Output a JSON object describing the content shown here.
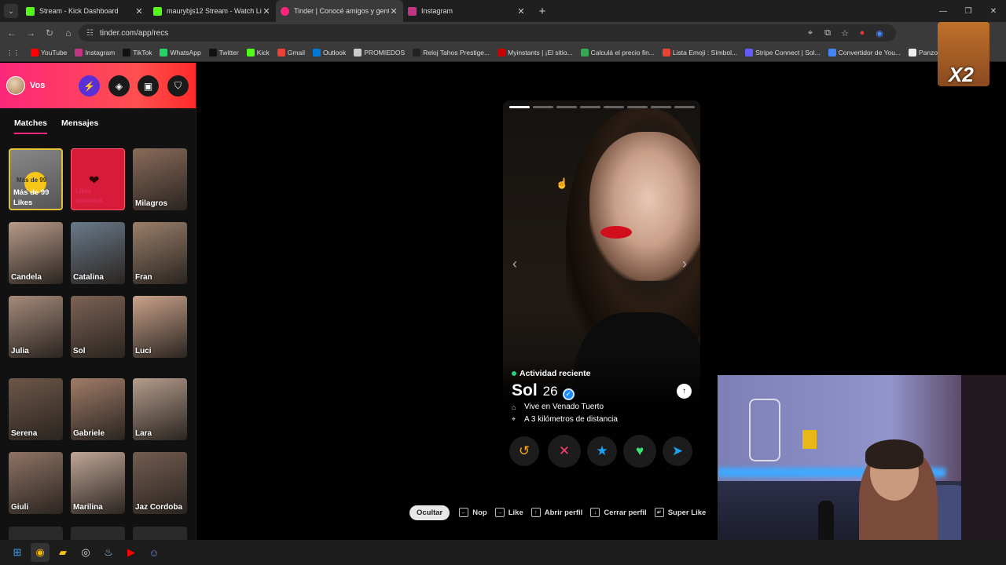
{
  "browser": {
    "tabs": [
      {
        "title": "Stream - Kick Dashboard",
        "color": "#53fc18"
      },
      {
        "title": "maurybjs12 Stream - Watch Live",
        "color": "#53fc18"
      },
      {
        "title": "Tinder | Conocé amigos y gente",
        "color": "#fd267a"
      },
      {
        "title": "Instagram",
        "color": "#c13584"
      }
    ],
    "url": "tinder.com/app/recs",
    "bookmarks": [
      {
        "label": "YouTube",
        "color": "#ff0000"
      },
      {
        "label": "Instagram",
        "color": "#c13584"
      },
      {
        "label": "TikTok",
        "color": "#111111"
      },
      {
        "label": "WhatsApp",
        "color": "#25d366"
      },
      {
        "label": "Twitter",
        "color": "#111111"
      },
      {
        "label": "Kick",
        "color": "#53fc18"
      },
      {
        "label": "Gmail",
        "color": "#ea4335"
      },
      {
        "label": "Outlook",
        "color": "#0078d4"
      },
      {
        "label": "PROMIEDOS",
        "color": "#cccccc"
      },
      {
        "label": "Reloj Tahos Prestige...",
        "color": "#222222"
      },
      {
        "label": "Myinstants | ¡El sitio...",
        "color": "#cc0000"
      },
      {
        "label": "Calculá el precio fin...",
        "color": "#34a853"
      },
      {
        "label": "Lista Emoji : Símbol...",
        "color": "#ea4335"
      },
      {
        "label": "Stripe Connect | Sol...",
        "color": "#635bff"
      },
      {
        "label": "Convertidor de You...",
        "color": "#4285f4"
      },
      {
        "label": "Panzoid",
        "color": "#eeeeee"
      }
    ]
  },
  "sidebar": {
    "user": "Vos",
    "tabs": [
      "Matches",
      "Mensajes"
    ],
    "likes_card": {
      "top": "Más de 99",
      "label": "Más de 99 Likes"
    },
    "sent_card": {
      "label": "Likes enviados"
    },
    "matches": [
      "Milagros",
      "Candela",
      "Catalina",
      "Fran",
      "Julia",
      "Sol",
      "Luci",
      "Serena",
      "Gabriele",
      "Lara",
      "Giuli",
      "Marilina",
      "Jaz Cordoba"
    ]
  },
  "profile": {
    "status": "Actividad reciente",
    "name": "Sol",
    "age": "26",
    "lives": "Vive en Venado Tuerto",
    "distance": "A 3 kilómetros de distancia",
    "photos_total": 8,
    "photo_index": 1
  },
  "hints": {
    "hide": "Ocultar",
    "items": [
      "Nop",
      "Like",
      "Abrir perfil",
      "Cerrar perfil",
      "Super Like"
    ]
  },
  "emote": {
    "text": "X2"
  },
  "colors": {
    "brand": "#fd267a",
    "accent": "#ff4f4f",
    "like": "#3ae374",
    "superlike": "#1da1f2",
    "nope": "#fe3c72",
    "rewind": "#f5a623"
  }
}
